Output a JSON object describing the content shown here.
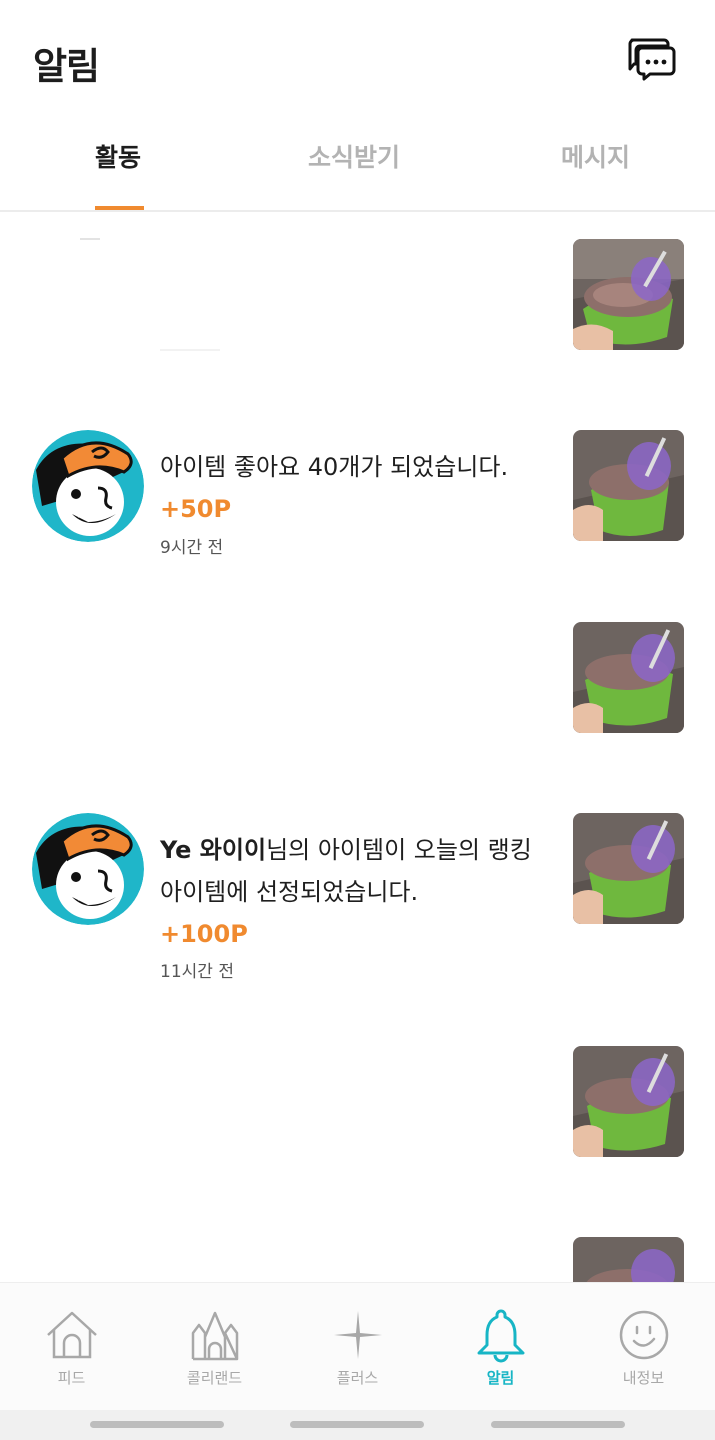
{
  "header": {
    "title": "알림",
    "chat_icon": "chat-bubbles-icon"
  },
  "tabs": [
    {
      "label": "활동",
      "active": true
    },
    {
      "label": "소식받기",
      "active": false
    },
    {
      "label": "메시지",
      "active": false
    }
  ],
  "notifications": [
    {
      "text_pre": "아이템 좋아요 40개가 되었습니다.",
      "points": "+50P",
      "time": "9시간 전"
    },
    {
      "bold_user": "Ye 와이이",
      "text_pre": "님의 아이템이 오늘의 랭킹 아이템에 선정되었습니다.",
      "points": "+100P",
      "time": "11시간 전"
    }
  ],
  "tabbar": [
    {
      "label": "피드",
      "icon": "house-icon",
      "active": false
    },
    {
      "label": "콜리랜드",
      "icon": "castle-icon",
      "active": false
    },
    {
      "label": "플러스",
      "icon": "sparkle-plus-icon",
      "active": false
    },
    {
      "label": "알림",
      "icon": "bell-icon",
      "active": true
    },
    {
      "label": "내정보",
      "icon": "smiley-icon",
      "active": false
    }
  ],
  "colors": {
    "accent_orange": "#f08a2f",
    "active_teal": "#17b5c5",
    "avatar_teal": "#1fb6c9"
  }
}
